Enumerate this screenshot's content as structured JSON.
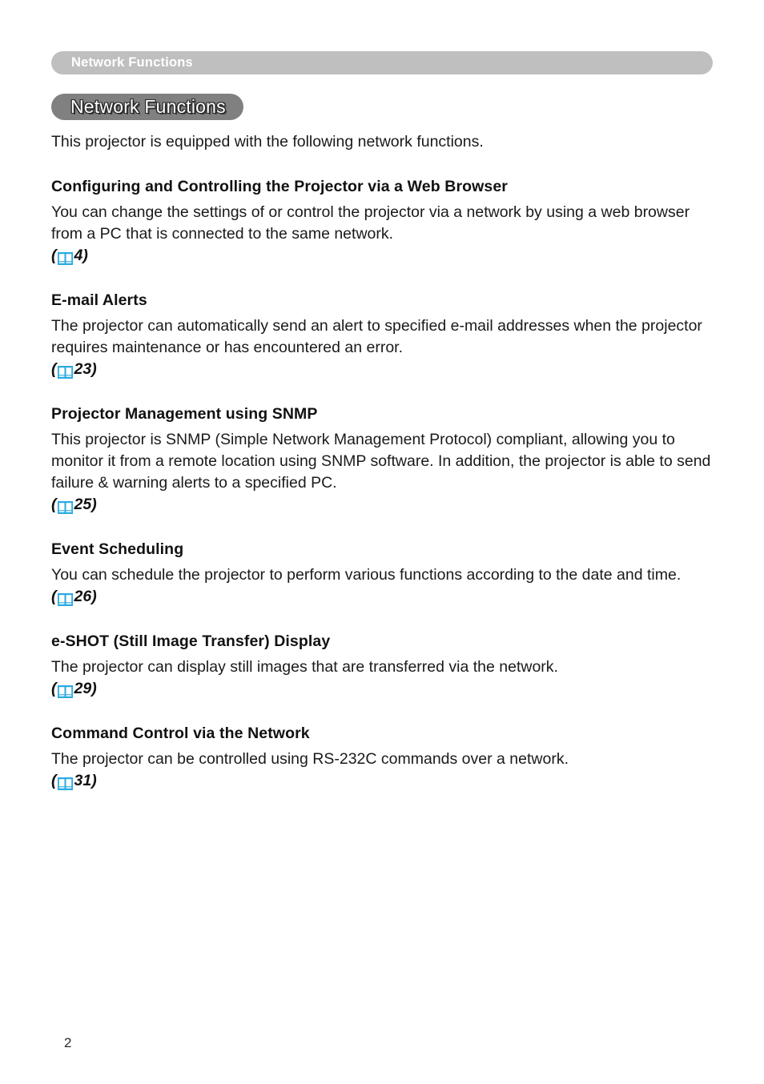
{
  "running_header": {
    "label": "Network Functions"
  },
  "title": {
    "label": "Network Functions"
  },
  "intro": "This projector is equipped with the following network functions.",
  "sections": [
    {
      "heading": "Configuring and Controlling the Projector via a Web Browser",
      "body": "You can change the settings of or control the projector via a network by using a web browser from a PC that is connected to the same network.",
      "ref_open": "(",
      "ref_icon": "book-icon",
      "ref_page": "4",
      "ref_close": ")"
    },
    {
      "heading": "E-mail Alerts",
      "body": "The projector can automatically send an alert to specified e-mail addresses when the projector requires maintenance or has encountered an error.",
      "ref_open": "(",
      "ref_icon": "book-icon",
      "ref_page": "23",
      "ref_close": ")"
    },
    {
      "heading": "Projector Management using SNMP",
      "body": "This projector is SNMP (Simple Network Management Protocol) compliant, allowing you to monitor it from a remote location using SNMP software. In addition, the projector is able to send failure & warning alerts to a specified PC.",
      "ref_open": "(",
      "ref_icon": "book-icon",
      "ref_page": "25",
      "ref_close": ")"
    },
    {
      "heading": "Event Scheduling",
      "body": "You can schedule the projector to perform various functions according to the date and time.",
      "ref_open": "(",
      "ref_icon": "book-icon",
      "ref_page": "26",
      "ref_close": ")"
    },
    {
      "heading": "e-SHOT (Still Image Transfer) Display",
      "body": "The projector can display still images that are transferred via the network.",
      "ref_open": "(",
      "ref_icon": "book-icon",
      "ref_page": "29",
      "ref_close": ")"
    },
    {
      "heading": "Command Control via the Network",
      "body": "The projector can be controlled using RS-232C commands over a network.",
      "ref_open": "(",
      "ref_icon": "book-icon",
      "ref_page": "31",
      "ref_close": ")"
    }
  ],
  "footer": {
    "page_number": "2"
  },
  "colors": {
    "running_header_bg": "#bfbfbf",
    "title_pill_bg": "#808080",
    "book_icon": "#29aae1",
    "text": "#1a1a1a"
  }
}
